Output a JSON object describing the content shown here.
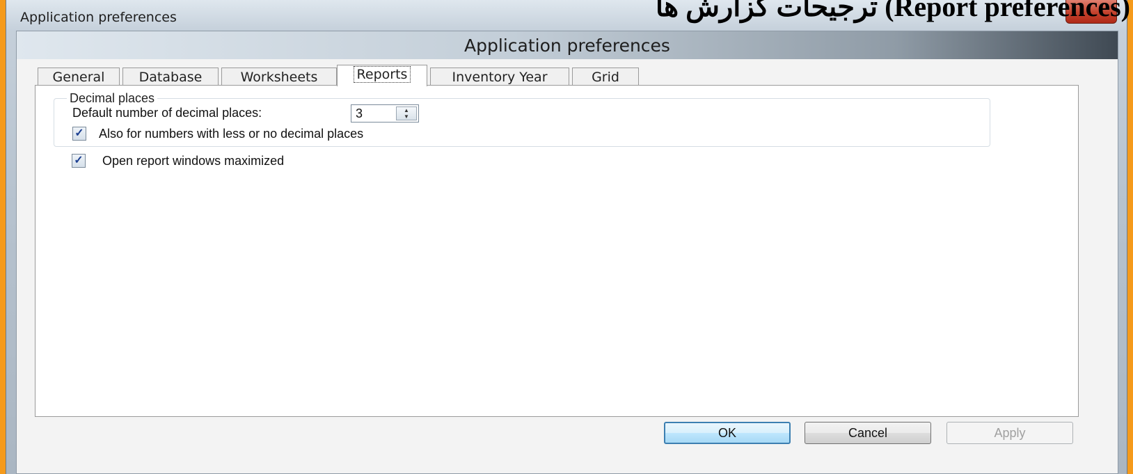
{
  "window": {
    "title": "Application preferences"
  },
  "overlay_title": "ترجیحات گزارش ها (Report preferences)",
  "dialog": {
    "header_title": "Application preferences",
    "tabs": [
      {
        "label": "General"
      },
      {
        "label": "Database"
      },
      {
        "label": "Worksheets"
      },
      {
        "label": "Reports"
      },
      {
        "label": "Inventory Year"
      },
      {
        "label": "Grid"
      }
    ],
    "active_tab": "Reports",
    "decimal_group": {
      "legend": "Decimal places",
      "default_label": "Default number of decimal places:",
      "default_value": "3",
      "also_checkbox_label": "Also for numbers with less or no decimal places",
      "also_checked": true
    },
    "maximize_checkbox_label": "Open report windows maximized",
    "maximize_checked": true,
    "buttons": {
      "ok": "OK",
      "cancel": "Cancel",
      "apply": "Apply"
    }
  },
  "colors": {
    "background": "#f59a1b",
    "close_button": "#c4412c",
    "default_button_border": "#3c7fb1"
  }
}
